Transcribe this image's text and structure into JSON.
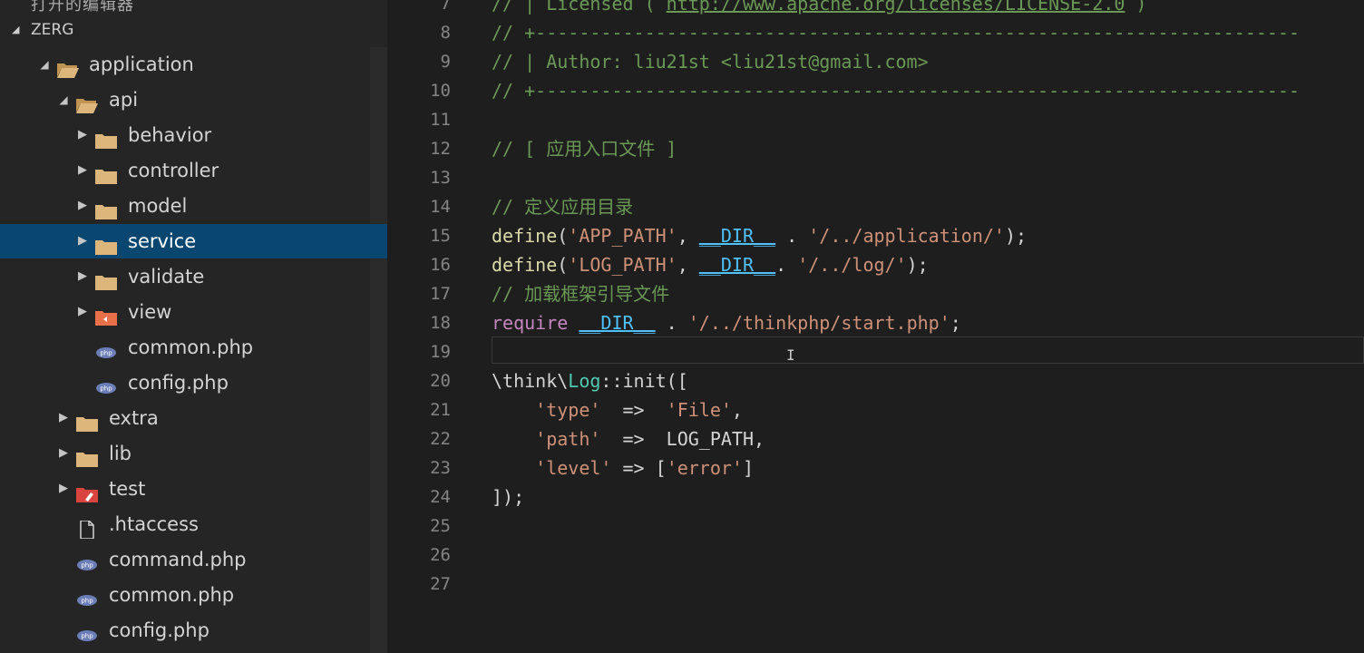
{
  "explorer": {
    "top_clipped_title": "打开的编辑器",
    "project_name": "ZERG",
    "tree": [
      {
        "label": "application",
        "type": "folder",
        "expanded": true
      },
      {
        "label": "api",
        "type": "folder",
        "expanded": true
      },
      {
        "label": "behavior",
        "type": "folder",
        "expanded": false
      },
      {
        "label": "controller",
        "type": "folder",
        "expanded": false
      },
      {
        "label": "model",
        "type": "folder",
        "expanded": false
      },
      {
        "label": "service",
        "type": "folder",
        "expanded": false,
        "selected": true
      },
      {
        "label": "validate",
        "type": "folder",
        "expanded": false
      },
      {
        "label": "view",
        "type": "folder-view",
        "expanded": false
      },
      {
        "label": "common.php",
        "type": "php-file"
      },
      {
        "label": "config.php",
        "type": "php-file"
      },
      {
        "label": "extra",
        "type": "folder",
        "expanded": false
      },
      {
        "label": "lib",
        "type": "folder",
        "expanded": false
      },
      {
        "label": "test",
        "type": "folder-test",
        "expanded": false
      },
      {
        "label": ".htaccess",
        "type": "file"
      },
      {
        "label": "command.php",
        "type": "php-file"
      },
      {
        "label": "common.php",
        "type": "php-file"
      },
      {
        "label": "config.php",
        "type": "php-file"
      }
    ]
  },
  "editor": {
    "line_numbers": [
      "7",
      "8",
      "9",
      "10",
      "11",
      "12",
      "13",
      "14",
      "15",
      "16",
      "17",
      "18",
      "19",
      "20",
      "21",
      "22",
      "23",
      "24",
      "25",
      "26",
      "27"
    ],
    "lines": {
      "l7a": "// | Licensed ( ",
      "l7b": "http://www.apache.org/licenses/LICENSE-2.0",
      "l7c": " )",
      "l8": "// +----------------------------------------------------------------------",
      "l9": "// | Author: liu21st <liu21st@gmail.com>",
      "l10": "// +----------------------------------------------------------------------",
      "l12": "// [ 应用入口文件 ]",
      "l14": "// 定义应用目录",
      "l15_fn": "define",
      "l15_p1": "(",
      "l15_s1": "'APP_PATH'",
      "l15_p2": ", ",
      "l15_c": "__DIR__",
      "l15_p3": " . ",
      "l15_s2": "'/../application/'",
      "l15_p4": ");",
      "l16_fn": "define",
      "l16_p1": "(",
      "l16_s1": "'LOG_PATH'",
      "l16_p2": ", ",
      "l16_c": "__DIR__",
      "l16_p3": ". ",
      "l16_s2": "'/../log/'",
      "l16_p4": ");",
      "l17": "// 加载框架引导文件",
      "l18_kw": "require",
      "l18_sp": " ",
      "l18_c": "__DIR__",
      "l18_p": " . ",
      "l18_s": "'/../thinkphp/start.php'",
      "l18_end": ";",
      "l20_a": "\\think\\",
      "l20_cls": "Log",
      "l20_b": "::init([",
      "l21_ind": "    ",
      "l21_s1": "'type'",
      "l21_arr": "  =>  ",
      "l21_s2": "'File'",
      "l21_end": ",",
      "l22_ind": "    ",
      "l22_s1": "'path'",
      "l22_arr": "  =>  LOG_PATH,",
      "l23_ind": "    ",
      "l23_s1": "'level'",
      "l23_arr": " => [",
      "l23_s2": "'error'",
      "l23_end": "]",
      "l24": "]);"
    },
    "cursor_glyph": "I"
  }
}
